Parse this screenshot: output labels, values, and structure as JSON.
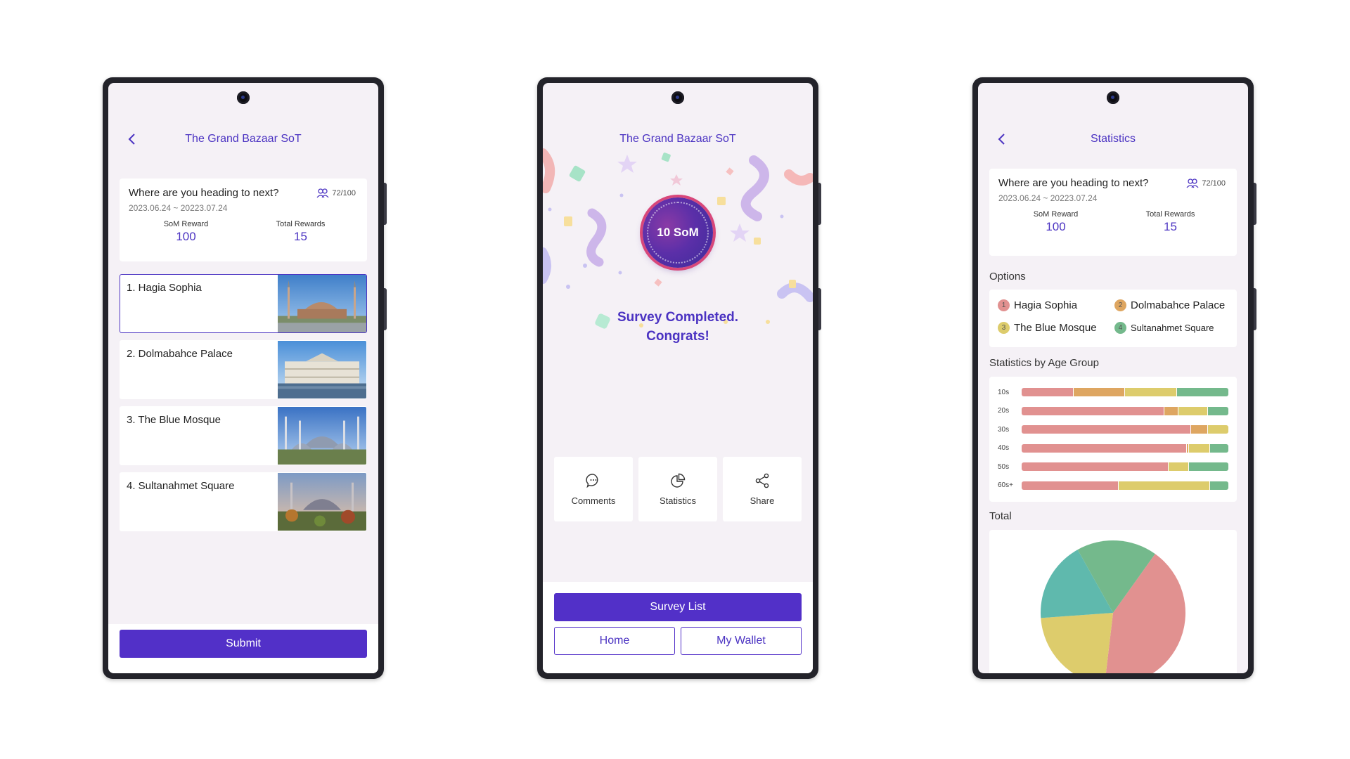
{
  "colors": {
    "accent": "#5230c8",
    "opt1": "#e19190",
    "opt2": "#dea661",
    "opt3": "#ddcc6c",
    "opt4": "#74b98c",
    "teal": "#5fb9ad"
  },
  "survey": {
    "app_title": "The Grand Bazaar SoT",
    "question": "Where are you heading to next?",
    "participants": "72/100",
    "date_range": "2023.06.24 ~ 20223.07.24",
    "som_reward_label": "SoM Reward",
    "som_reward_value": "100",
    "total_rewards_label": "Total Rewards",
    "total_rewards_value": "15"
  },
  "vote_screen": {
    "options": [
      {
        "label": "1. Hagia Sophia",
        "selected": true
      },
      {
        "label": "2. Dolmabahce Palace",
        "selected": false
      },
      {
        "label": "3. The Blue Mosque",
        "selected": false
      },
      {
        "label": "4. Sultanahmet Square",
        "selected": false
      }
    ],
    "submit_label": "Submit"
  },
  "complete_screen": {
    "coin_label": "10 SoM",
    "message_line1": "Survey Completed.",
    "message_line2": "Congrats!",
    "actions": [
      {
        "label": "Comments",
        "icon": "comment-icon"
      },
      {
        "label": "Statistics",
        "icon": "pie-chart-icon"
      },
      {
        "label": "Share",
        "icon": "share-icon"
      }
    ],
    "survey_list_label": "Survey List",
    "home_label": "Home",
    "wallet_label": "My Wallet"
  },
  "stats_screen": {
    "title": "Statistics",
    "options_heading": "Options",
    "options": [
      {
        "num": "1",
        "label": "Hagia Sophia"
      },
      {
        "num": "2",
        "label": "Dolmabahce Palace"
      },
      {
        "num": "3",
        "label": "The Blue Mosque"
      },
      {
        "num": "4",
        "label": "Sultanahmet Square"
      }
    ],
    "age_heading": "Statistics by Age Group",
    "total_heading": "Total"
  },
  "chart_data": [
    {
      "type": "bar",
      "stacked": true,
      "orientation": "horizontal",
      "categories": [
        "10s",
        "20s",
        "30s",
        "40s",
        "50s",
        "60s+"
      ],
      "series": [
        {
          "values": [
            25,
            69,
            82,
            80,
            71,
            47
          ]
        },
        {
          "values": [
            25,
            7,
            8,
            1,
            0,
            0
          ]
        },
        {
          "values": [
            25,
            14,
            10,
            10,
            10,
            44
          ]
        },
        {
          "values": [
            25,
            10,
            0,
            9,
            19,
            9
          ]
        }
      ]
    },
    {
      "type": "pie",
      "slices": [
        {
          "option": "1",
          "value": 42
        },
        {
          "option": "3",
          "value": 22
        },
        {
          "option": "teal",
          "value": 18
        },
        {
          "option": "4",
          "value": 18
        }
      ]
    }
  ]
}
